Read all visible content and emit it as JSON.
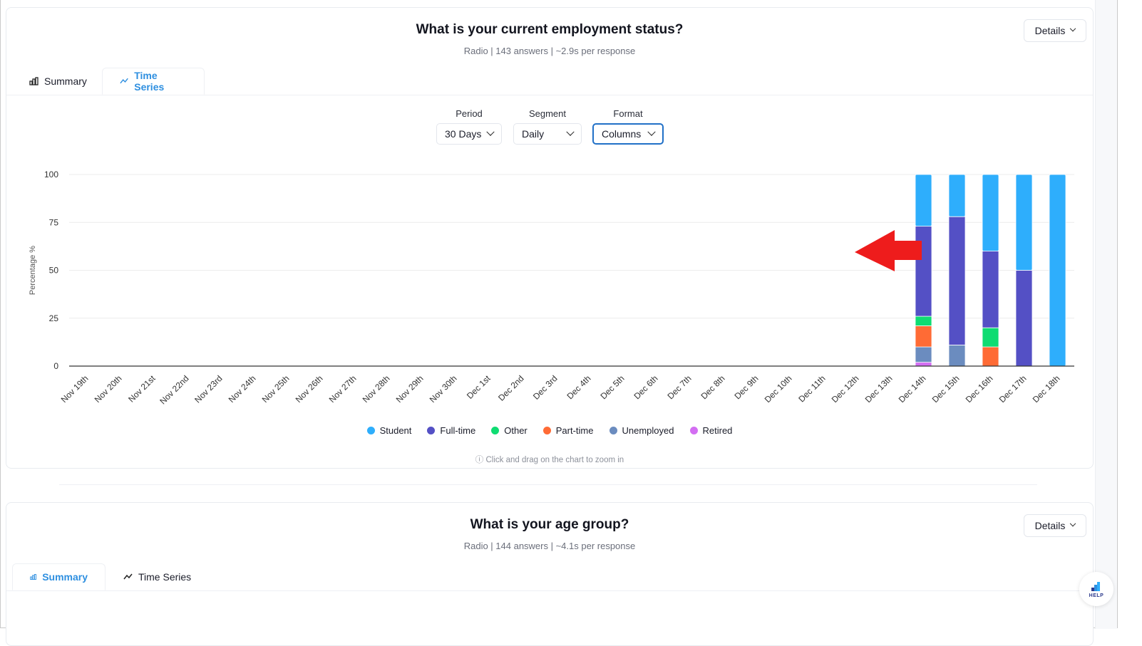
{
  "question1": {
    "title": "What is your current employment status?",
    "subtitle": "Radio | 143 answers | ~2.9s per response",
    "details_label": "Details",
    "tabs": [
      {
        "label": "Summary",
        "icon": "bar-chart-icon",
        "active": false
      },
      {
        "label": "Time Series",
        "icon": "trend-line-icon",
        "active": true
      }
    ],
    "controls": {
      "period": {
        "label": "Period",
        "value": "30 Days"
      },
      "segment": {
        "label": "Segment",
        "value": "Daily"
      },
      "format": {
        "label": "Format",
        "value": "Columns"
      }
    },
    "hint": "Click and drag on the chart to zoom in"
  },
  "question2": {
    "title": "What is your age group?",
    "subtitle": "Radio | 144 answers | ~4.1s per response",
    "details_label": "Details",
    "tabs": [
      {
        "label": "Summary",
        "icon": "bar-chart-icon",
        "active": true
      },
      {
        "label": "Time Series",
        "icon": "trend-line-icon",
        "active": false
      }
    ]
  },
  "help_label": "HELP",
  "chart_data": {
    "type": "bar",
    "stacked": true,
    "title": "",
    "xlabel": "",
    "ylabel": "Percentage %",
    "ylim": [
      0,
      100
    ],
    "yticks": [
      0,
      25,
      50,
      75,
      100
    ],
    "grid": true,
    "legend_position": "bottom",
    "categories": [
      "Nov 19th",
      "Nov 20th",
      "Nov 21st",
      "Nov 22nd",
      "Nov 23rd",
      "Nov 24th",
      "Nov 25th",
      "Nov 26th",
      "Nov 27th",
      "Nov 28th",
      "Nov 29th",
      "Nov 30th",
      "Dec 1st",
      "Dec 2nd",
      "Dec 3rd",
      "Dec 4th",
      "Dec 5th",
      "Dec 6th",
      "Dec 7th",
      "Dec 8th",
      "Dec 9th",
      "Dec 10th",
      "Dec 11th",
      "Dec 12th",
      "Dec 13th",
      "Dec 14th",
      "Dec 15th",
      "Dec 16th",
      "Dec 17th",
      "Dec 18th"
    ],
    "series": [
      {
        "name": "Retired",
        "color": "#d36ef2",
        "values": [
          0,
          0,
          0,
          0,
          0,
          0,
          0,
          0,
          0,
          0,
          0,
          0,
          0,
          0,
          0,
          0,
          0,
          0,
          0,
          0,
          0,
          0,
          0,
          0,
          0,
          2,
          0,
          0,
          0,
          0
        ]
      },
      {
        "name": "Unemployed",
        "color": "#6b8cbf",
        "values": [
          0,
          0,
          0,
          0,
          0,
          0,
          0,
          0,
          0,
          0,
          0,
          0,
          0,
          0,
          0,
          0,
          0,
          0,
          0,
          0,
          0,
          0,
          0,
          0,
          0,
          8,
          11,
          0,
          0,
          0
        ]
      },
      {
        "name": "Part-time",
        "color": "#ff6b35",
        "values": [
          0,
          0,
          0,
          0,
          0,
          0,
          0,
          0,
          0,
          0,
          0,
          0,
          0,
          0,
          0,
          0,
          0,
          0,
          0,
          0,
          0,
          0,
          0,
          0,
          0,
          11,
          0,
          10,
          0,
          0
        ]
      },
      {
        "name": "Other",
        "color": "#0fdc72",
        "values": [
          0,
          0,
          0,
          0,
          0,
          0,
          0,
          0,
          0,
          0,
          0,
          0,
          0,
          0,
          0,
          0,
          0,
          0,
          0,
          0,
          0,
          0,
          0,
          0,
          0,
          5,
          0,
          10,
          0,
          0
        ]
      },
      {
        "name": "Full-time",
        "color": "#5450c5",
        "values": [
          0,
          0,
          0,
          0,
          0,
          0,
          0,
          0,
          0,
          0,
          0,
          0,
          0,
          0,
          0,
          0,
          0,
          0,
          0,
          0,
          0,
          0,
          0,
          0,
          0,
          47,
          67,
          40,
          50,
          0
        ]
      },
      {
        "name": "Student",
        "color": "#2eaefc",
        "values": [
          0,
          0,
          0,
          0,
          0,
          0,
          0,
          0,
          0,
          0,
          0,
          0,
          0,
          0,
          0,
          0,
          0,
          0,
          0,
          0,
          0,
          0,
          0,
          0,
          0,
          27,
          22,
          40,
          50,
          100
        ]
      }
    ],
    "legend_order": [
      "Student",
      "Full-time",
      "Other",
      "Part-time",
      "Unemployed",
      "Retired"
    ],
    "annotations": [
      {
        "type": "arrow",
        "color": "#ee1c1c",
        "points_to": "Dec 14th"
      }
    ]
  }
}
